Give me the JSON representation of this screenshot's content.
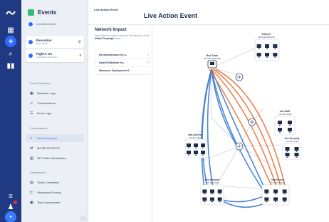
{
  "app": {
    "title": "Events",
    "subtitle": "Live Action Event"
  },
  "sidebar": {
    "cards": [
      {
        "label": "Execution",
        "sub": "Event Phase",
        "right": "⚙"
      },
      {
        "label": "Fight's On",
        "sub": "12/20/2023 10:21 AM",
        "right": "▾"
      }
    ],
    "sections": [
      {
        "title": "Event Execution",
        "items": [
          "Defender Logs",
          "Threat Actions",
          "Event Logs"
        ]
      },
      {
        "title": "Visualizations",
        "items": [
          "Network Impact",
          "MITRE ATT&CK®",
          "UE Traffic Visualization"
        ]
      },
      {
        "title": "Assessment",
        "items": [
          "Ticket Correlation",
          "Objectives Scoring",
          "Team Assessment"
        ]
      }
    ],
    "active_item": "Network Impact"
  },
  "header": {
    "breadcrumb": "Live Action Event",
    "title": "Live Action Event"
  },
  "impact": {
    "title": "Network Impact",
    "desc_prefix": "View network activity involved in the execution of the",
    "desc_bold": "Attack Campaign",
    "desc_suffix": "below.",
    "items": [
      {
        "label": "Reconnaissance by a...",
        "done": true
      },
      {
        "label": "Data Exfiltration fro...",
        "done": true
      },
      {
        "label": "Beaconer Deployment S...",
        "done": false
      }
    ]
  },
  "map": {
    "labels": {
      "internet": "Internet",
      "internet_ip": "209.200.250.0/24",
      "red_team": "Red Team",
      "red_team_ip": "215.216.209.0/24",
      "sensor": "site-Sensors",
      "sensor_ip": "172.16.1.0/24",
      "dmz": "site-DMZ",
      "dmz_ip": "172.16.3.0/24",
      "security": "site-Security",
      "security_ip": "172.16.5.0/24",
      "servers": "site-Servers",
      "servers_ip": "172.16.2.0/24",
      "recon": "site-Recon",
      "recon_ip": "172.16.4.0/24"
    },
    "colors": {
      "blue_path": "#3a7bd5",
      "orange_path": "#e8743b"
    }
  }
}
